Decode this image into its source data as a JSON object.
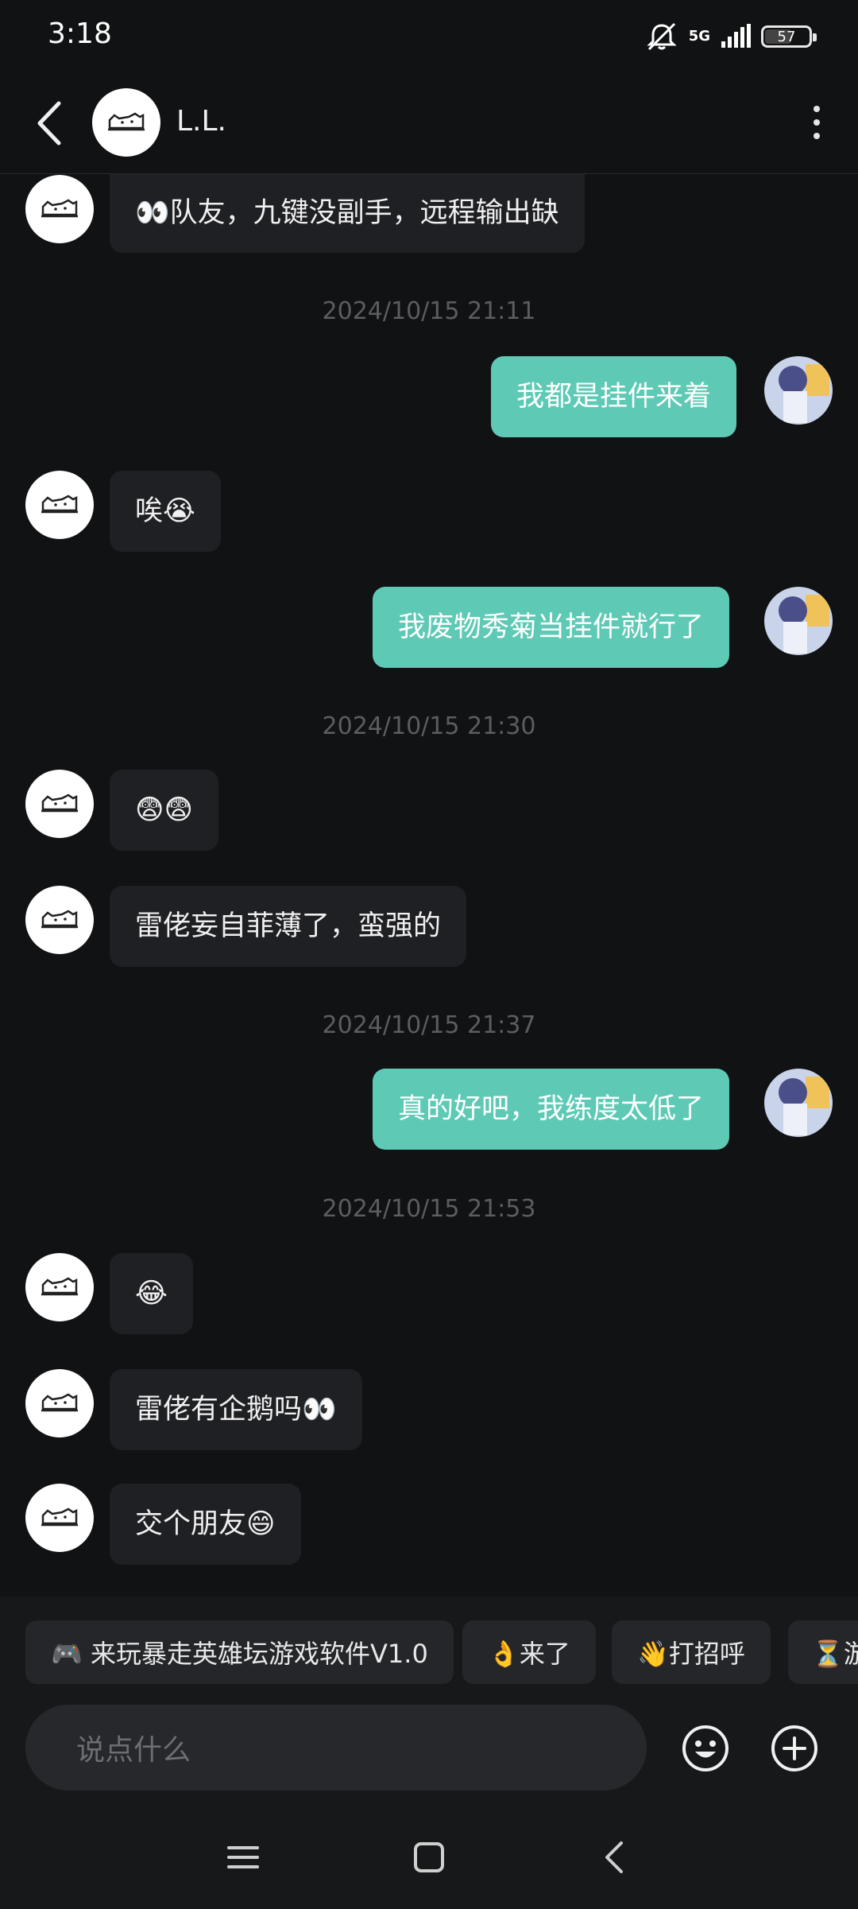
{
  "status_bar": {
    "time": "3:18",
    "network": "5G",
    "battery": "57",
    "battery_level": 0.57,
    "icons": [
      "silent-icon",
      "signal-icon",
      "battery-icon"
    ]
  },
  "header": {
    "contact_name": "L.L.",
    "icons": [
      "back-icon",
      "avatar-cat-icon",
      "more-vertical-icon"
    ]
  },
  "messages": [
    {
      "kind": "in",
      "text": "👀队友，九键没副手，远程输出缺"
    },
    {
      "kind": "time",
      "text": "2024/10/15  21:11"
    },
    {
      "kind": "out",
      "text": "我都是挂件来着"
    },
    {
      "kind": "in",
      "text": "唉😭"
    },
    {
      "kind": "out",
      "text": "我废物秀菊当挂件就行了"
    },
    {
      "kind": "time",
      "text": "2024/10/15  21:30"
    },
    {
      "kind": "in",
      "text": "😨😨"
    },
    {
      "kind": "in",
      "text": "雷佬妄自菲薄了，蛮强的"
    },
    {
      "kind": "time",
      "text": "2024/10/15  21:37"
    },
    {
      "kind": "out",
      "text": "真的好吧，我练度太低了"
    },
    {
      "kind": "time",
      "text": "2024/10/15  21:53"
    },
    {
      "kind": "in",
      "text": "😂"
    },
    {
      "kind": "in",
      "text": "雷佬有企鹅吗👀"
    },
    {
      "kind": "in",
      "text": "交个朋友😄"
    }
  ],
  "quick_replies": [
    "🎮 来玩暴走英雄坛游戏软件V1.0",
    "👌来了",
    "👋打招呼",
    "⏳游"
  ],
  "input": {
    "placeholder": "说点什么",
    "icons": [
      "emoji-icon",
      "add-icon"
    ]
  },
  "nav_bar": {
    "icons": [
      "menu-icon",
      "home-icon",
      "back-nav-icon"
    ]
  },
  "colors": {
    "background": "#111213",
    "incoming_bubble": "#1f2024",
    "outgoing_bubble": "#5ecab5",
    "timestamp": "#5b5d61"
  }
}
